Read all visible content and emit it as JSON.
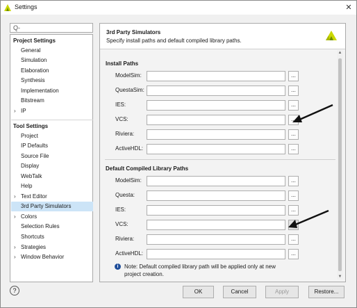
{
  "window": {
    "title": "Settings",
    "close_icon": "✕"
  },
  "search": {
    "icon": "Q-"
  },
  "tree": {
    "project_header": "Project Settings",
    "project_items": [
      "General",
      "Simulation",
      "Elaboration",
      "Synthesis",
      "Implementation",
      "Bitstream",
      "IP"
    ],
    "tool_header": "Tool Settings",
    "tool_items": [
      "Project",
      "IP Defaults",
      "Source File",
      "Display",
      "WebTalk",
      "Help",
      "Text Editor",
      "3rd Party Simulators",
      "Colors",
      "Selection Rules",
      "Shortcuts",
      "Strategies",
      "Window Behavior"
    ],
    "selected": "3rd Party Simulators"
  },
  "panel": {
    "title": "3rd Party Simulators",
    "subtitle": "Specify install paths and default compiled library paths."
  },
  "install_paths": {
    "header": "Install Paths",
    "rows": [
      {
        "label": "ModelSim:",
        "value": ""
      },
      {
        "label": "QuestaSim:",
        "value": ""
      },
      {
        "label": "IES:",
        "value": ""
      },
      {
        "label": "VCS:",
        "value": ""
      },
      {
        "label": "Riviera:",
        "value": ""
      },
      {
        "label": "ActiveHDL:",
        "value": ""
      }
    ]
  },
  "library_paths": {
    "header": "Default Compiled Library Paths",
    "rows": [
      {
        "label": "ModelSim:",
        "value": ""
      },
      {
        "label": "Questa:",
        "value": ""
      },
      {
        "label": "IES:",
        "value": ""
      },
      {
        "label": "VCS:",
        "value": ""
      },
      {
        "label": "Riviera:",
        "value": ""
      },
      {
        "label": "ActiveHDL:",
        "value": ""
      }
    ]
  },
  "browse_label": "...",
  "note": {
    "icon": "i",
    "text": "Note: Default compiled library path will be applied only at new project creation."
  },
  "footer": {
    "help": "?",
    "ok": "OK",
    "cancel": "Cancel",
    "apply": "Apply",
    "restore": "Restore..."
  },
  "colors": {
    "selection": "#cce4f7",
    "info_icon": "#1f4e9a",
    "logo_primary": "#c9d700",
    "arrow": "#111111"
  }
}
